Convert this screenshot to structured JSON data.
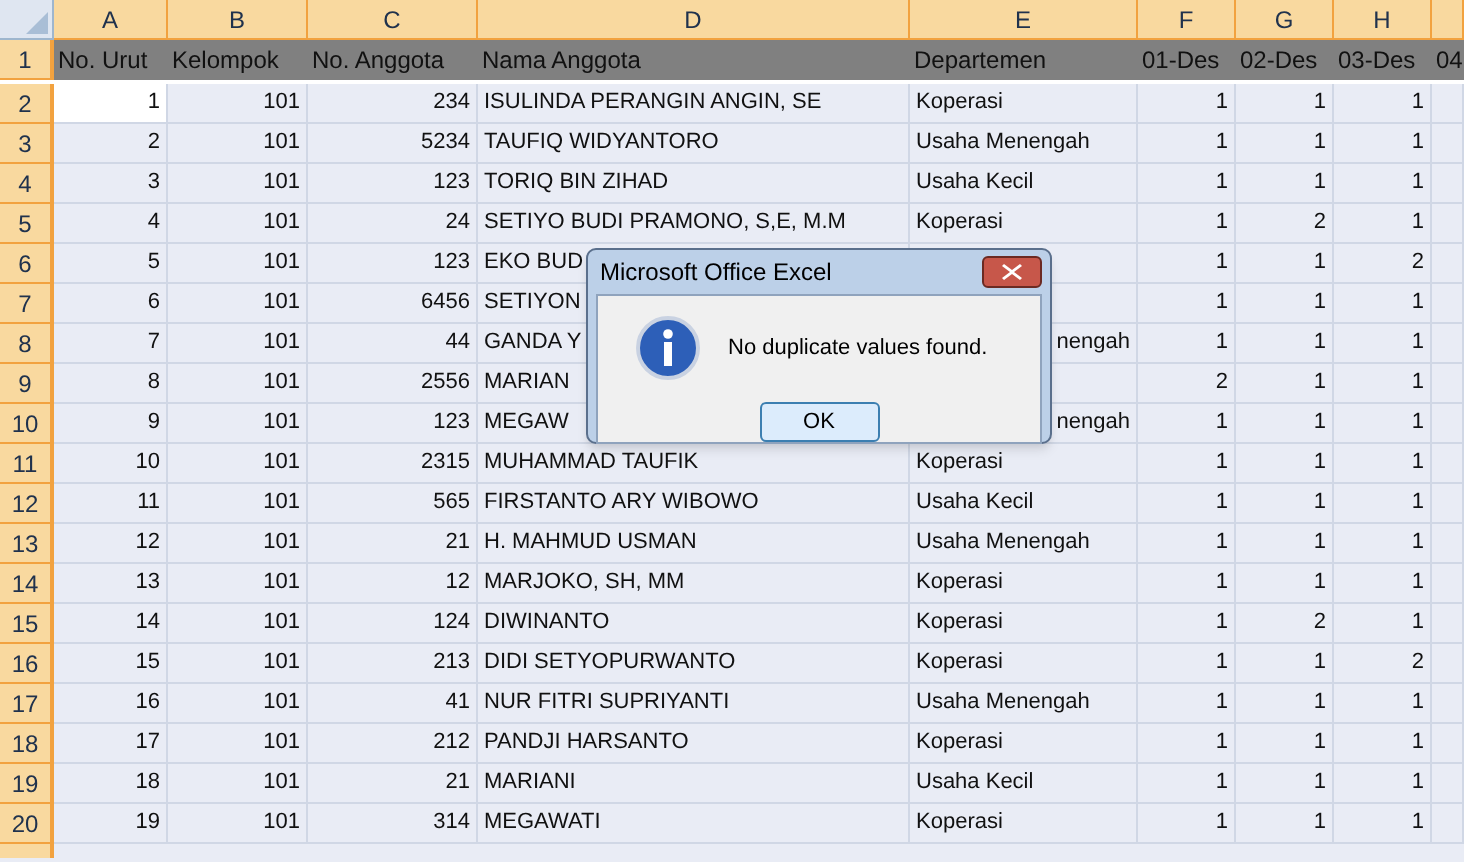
{
  "columns": [
    "A",
    "B",
    "C",
    "D",
    "E",
    "F",
    "G",
    "H",
    ""
  ],
  "header_row": {
    "number": "1",
    "cells": [
      "No. Urut",
      "Kelompok",
      "No. Anggota",
      "Nama Anggota",
      "Departemen",
      "01-Des",
      "02-Des",
      "03-Des",
      "04"
    ]
  },
  "rows": [
    {
      "number": "2",
      "active": true,
      "cells": [
        "1",
        "101",
        "234",
        "ISULINDA PERANGIN ANGIN, SE",
        "Koperasi",
        "1",
        "1",
        "1"
      ]
    },
    {
      "number": "3",
      "active": false,
      "cells": [
        "2",
        "101",
        "5234",
        "TAUFIQ WIDYANTORO",
        "Usaha Menengah",
        "1",
        "1",
        "1"
      ]
    },
    {
      "number": "4",
      "active": false,
      "cells": [
        "3",
        "101",
        "123",
        "TORIQ BIN ZIHAD",
        "Usaha Kecil",
        "1",
        "1",
        "1"
      ]
    },
    {
      "number": "5",
      "active": false,
      "cells": [
        "4",
        "101",
        "24",
        "SETIYO BUDI PRAMONO, S,E, M.M",
        "Koperasi",
        "1",
        "2",
        "1"
      ]
    },
    {
      "number": "6",
      "active": false,
      "cells": [
        "5",
        "101",
        "123",
        "EKO BUD",
        "",
        "1",
        "1",
        "2"
      ]
    },
    {
      "number": "7",
      "active": false,
      "cells": [
        "6",
        "101",
        "6456",
        "SETIYON",
        "",
        "1",
        "1",
        "1"
      ]
    },
    {
      "number": "8",
      "active": false,
      "cells": [
        "7",
        "101",
        "44",
        "GANDA Y",
        {
          "text": "nengah",
          "kind": "clipped"
        },
        "1",
        "1",
        "1"
      ]
    },
    {
      "number": "9",
      "active": false,
      "cells": [
        "8",
        "101",
        "2556",
        "MARIAN",
        "",
        "2",
        "1",
        "1"
      ]
    },
    {
      "number": "10",
      "active": false,
      "cells": [
        "9",
        "101",
        "123",
        "MEGAW",
        {
          "text": "nengah",
          "kind": "clipped"
        },
        "1",
        "1",
        "1"
      ]
    },
    {
      "number": "11",
      "active": false,
      "cells": [
        "10",
        "101",
        "2315",
        "MUHAMMAD TAUFIK",
        "Koperasi",
        "1",
        "1",
        "1"
      ]
    },
    {
      "number": "12",
      "active": false,
      "cells": [
        "11",
        "101",
        "565",
        "FIRSTANTO ARY WIBOWO",
        "Usaha Kecil",
        "1",
        "1",
        "1"
      ]
    },
    {
      "number": "13",
      "active": false,
      "cells": [
        "12",
        "101",
        "21",
        "H. MAHMUD USMAN",
        "Usaha Menengah",
        "1",
        "1",
        "1"
      ]
    },
    {
      "number": "14",
      "active": false,
      "cells": [
        "13",
        "101",
        "12",
        "MARJOKO, SH, MM",
        "Koperasi",
        "1",
        "1",
        "1"
      ]
    },
    {
      "number": "15",
      "active": false,
      "cells": [
        "14",
        "101",
        "124",
        "DIWINANTO",
        "Koperasi",
        "1",
        "2",
        "1"
      ]
    },
    {
      "number": "16",
      "active": false,
      "cells": [
        "15",
        "101",
        "213",
        "DIDI SETYOPURWANTO",
        "Koperasi",
        "1",
        "1",
        "2"
      ]
    },
    {
      "number": "17",
      "active": false,
      "cells": [
        "16",
        "101",
        "41",
        "NUR FITRI SUPRIYANTI",
        "Usaha Menengah",
        "1",
        "1",
        "1"
      ]
    },
    {
      "number": "18",
      "active": false,
      "cells": [
        "17",
        "101",
        "212",
        "PANDJI HARSANTO",
        "Koperasi",
        "1",
        "1",
        "1"
      ]
    },
    {
      "number": "19",
      "active": false,
      "cells": [
        "18",
        "101",
        "21",
        "MARIANI",
        "Usaha Kecil",
        "1",
        "1",
        "1"
      ]
    },
    {
      "number": "20",
      "active": false,
      "cells": [
        "19",
        "101",
        "314",
        "MEGAWATI",
        "Koperasi",
        "1",
        "1",
        "1"
      ]
    }
  ],
  "dialog": {
    "title": "Microsoft Office Excel",
    "message": "No duplicate values found.",
    "buttons": [
      "OK"
    ]
  }
}
